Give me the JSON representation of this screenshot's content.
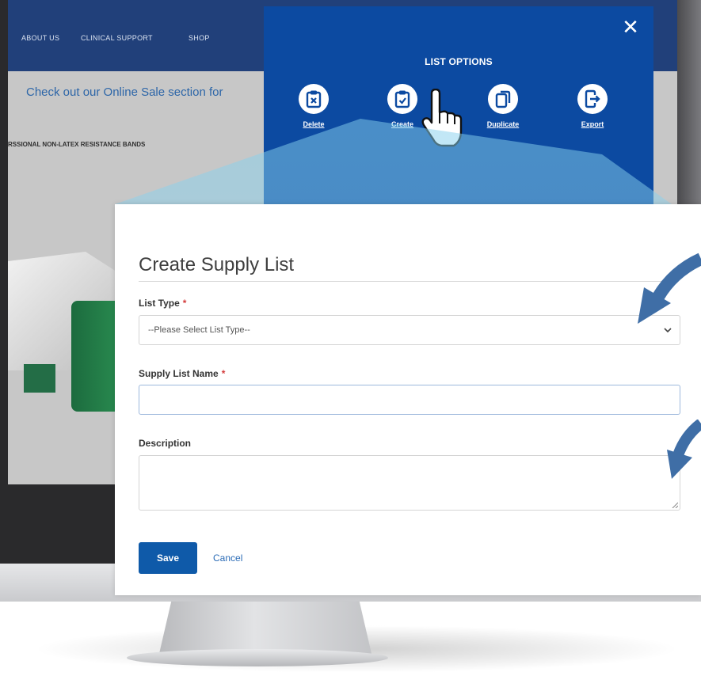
{
  "site": {
    "nav": [
      "ABOUT US",
      "CLINICAL SUPPORT",
      "SHOP"
    ],
    "promo_text": "Check out our Online Sale section for",
    "product_heading": "RSSIONAL NON-LATEX RESISTANCE BANDS"
  },
  "list_options": {
    "title": "LIST OPTIONS",
    "close_glyph": "✕",
    "items": [
      {
        "label": "Delete",
        "icon": "delete-clipboard-icon"
      },
      {
        "label": "Create",
        "icon": "create-clipboard-icon"
      },
      {
        "label": "Duplicate",
        "icon": "duplicate-icon"
      },
      {
        "label": "Export",
        "icon": "export-icon"
      }
    ],
    "accent_color": "#0c4aa1"
  },
  "modal": {
    "title": "Create Supply List",
    "required_marker": "*",
    "list_type": {
      "label": "List Type",
      "selected": "--Please Select List Type--"
    },
    "name": {
      "label": "Supply List Name",
      "value": ""
    },
    "description": {
      "label": "Description",
      "value": ""
    },
    "save_label": "Save",
    "cancel_label": "Cancel",
    "primary_color": "#0f5aa9"
  }
}
